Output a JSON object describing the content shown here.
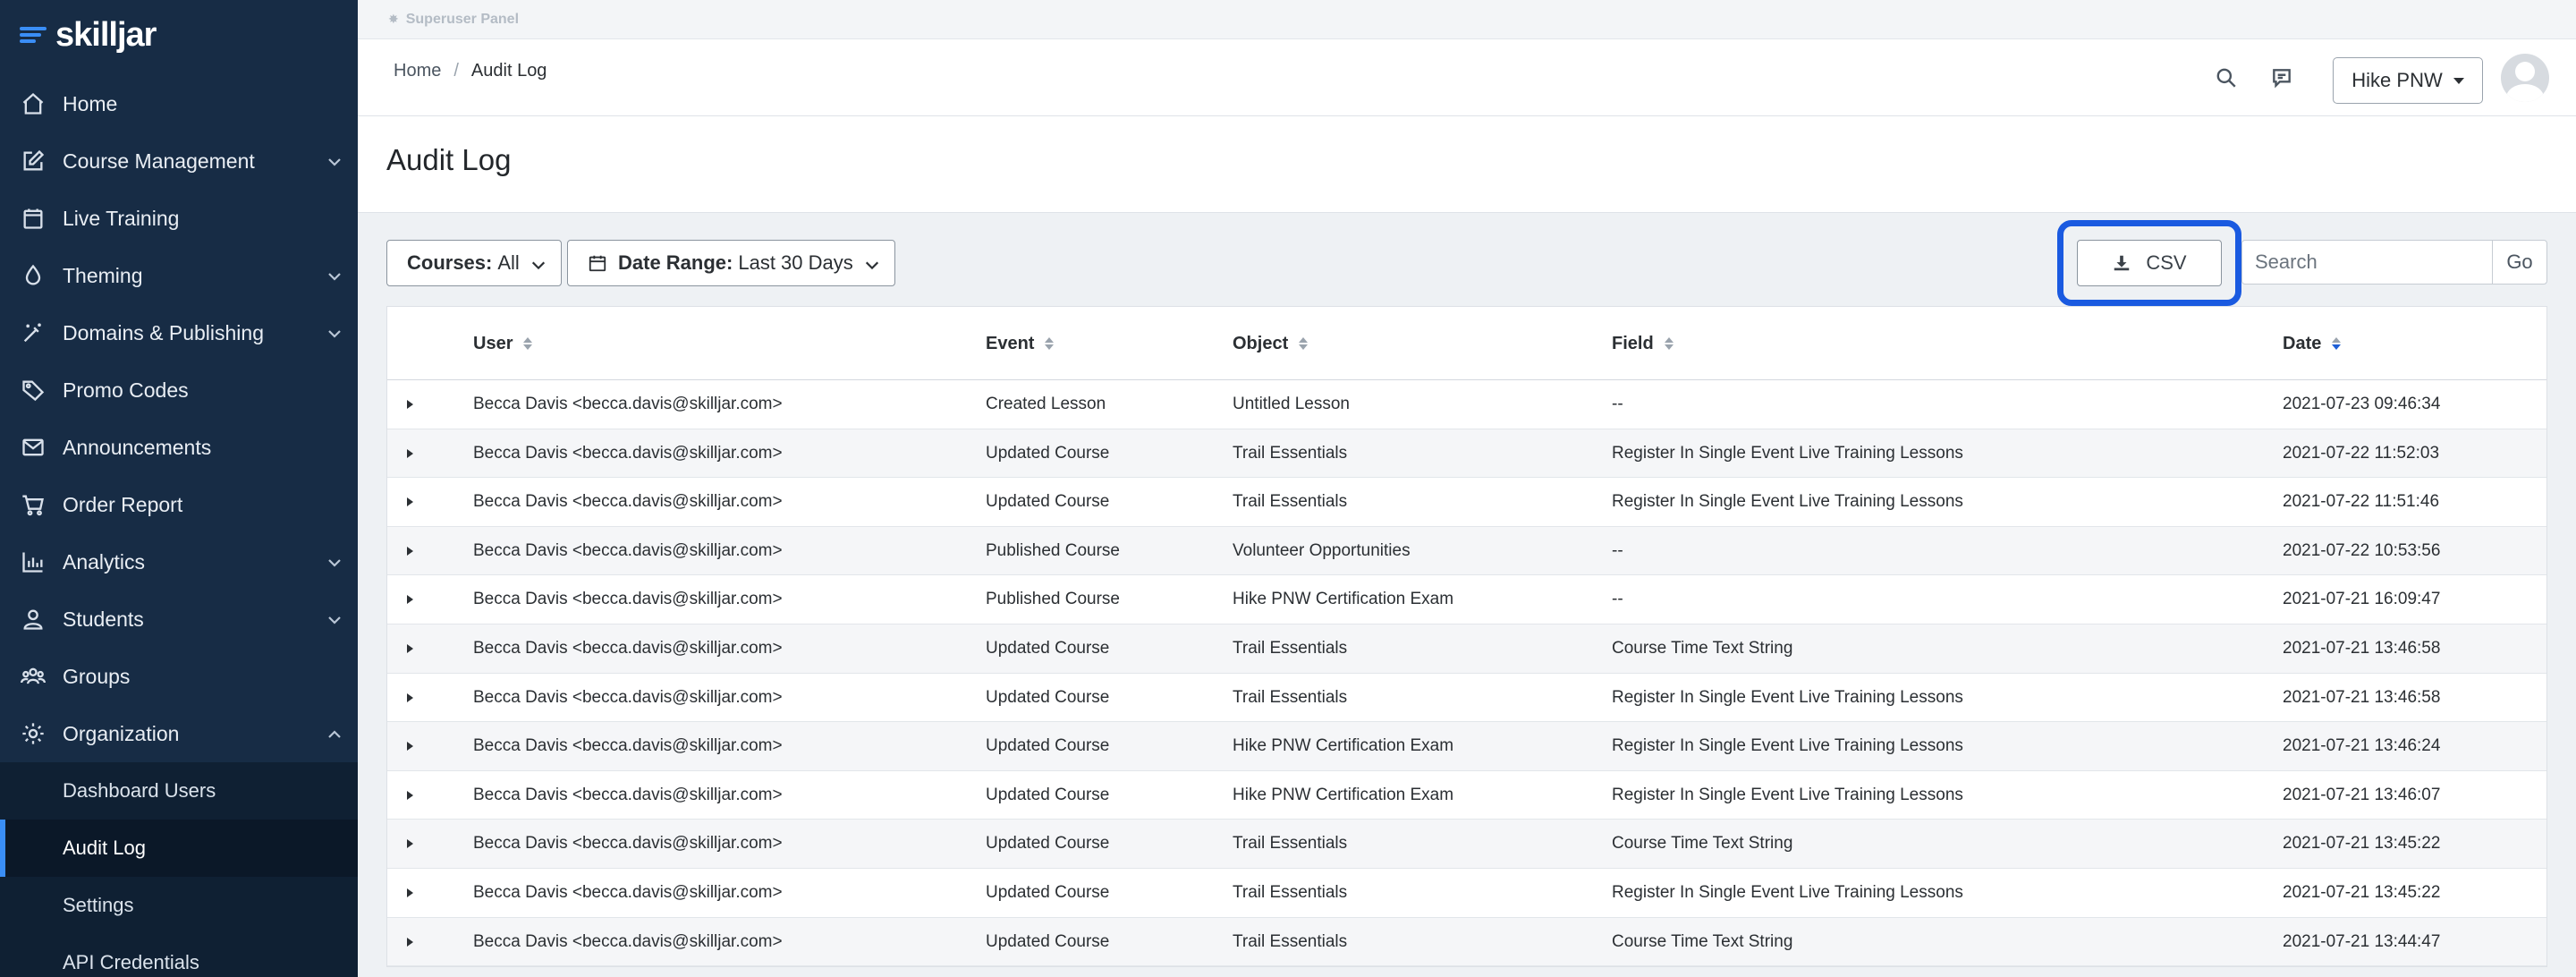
{
  "brand": {
    "name": "skilljar",
    "accent": "#3a8ef6"
  },
  "sidebar": {
    "items": [
      {
        "label": "Home",
        "icon": "home-icon",
        "expandable": false
      },
      {
        "label": "Course Management",
        "icon": "edit-icon",
        "expandable": true
      },
      {
        "label": "Live Training",
        "icon": "calendar-icon",
        "expandable": false
      },
      {
        "label": "Theming",
        "icon": "droplet-icon",
        "expandable": true
      },
      {
        "label": "Domains & Publishing",
        "icon": "magic-wand-icon",
        "expandable": true
      },
      {
        "label": "Promo Codes",
        "icon": "tag-icon",
        "expandable": false
      },
      {
        "label": "Announcements",
        "icon": "envelope-icon",
        "expandable": false
      },
      {
        "label": "Order Report",
        "icon": "cart-icon",
        "expandable": false
      },
      {
        "label": "Analytics",
        "icon": "bar-chart-icon",
        "expandable": true
      },
      {
        "label": "Students",
        "icon": "user-icon",
        "expandable": true
      },
      {
        "label": "Groups",
        "icon": "users-icon",
        "expandable": false
      },
      {
        "label": "Organization",
        "icon": "gear-icon",
        "expandable": true,
        "expanded": true
      }
    ],
    "subitems": [
      {
        "label": "Dashboard Users",
        "active": false
      },
      {
        "label": "Audit Log",
        "active": true
      },
      {
        "label": "Settings",
        "active": false
      },
      {
        "label": "API Credentials",
        "active": false
      }
    ]
  },
  "superuser": {
    "label": "Superuser Panel"
  },
  "breadcrumb": {
    "home": "Home",
    "separator": "/",
    "current": "Audit Log"
  },
  "header": {
    "org_name": "Hike PNW"
  },
  "page": {
    "title": "Audit Log"
  },
  "filters": {
    "courses_label": "Courses:",
    "courses_value": "All",
    "date_label": "Date Range:",
    "date_value": "Last 30 Days"
  },
  "toolbar": {
    "csv_label": "CSV",
    "search_placeholder": "Search",
    "go_label": "Go",
    "highlight_color": "#1a5ae0"
  },
  "table": {
    "columns": [
      "User",
      "Event",
      "Object",
      "Field",
      "Date"
    ],
    "sorted_column": "Date",
    "rows": [
      [
        "Becca Davis <becca.davis@skilljar.com>",
        "Created Lesson",
        "Untitled Lesson",
        "--",
        "2021-07-23 09:46:34"
      ],
      [
        "Becca Davis <becca.davis@skilljar.com>",
        "Updated Course",
        "Trail Essentials",
        "Register In Single Event Live Training Lessons",
        "2021-07-22 11:52:03"
      ],
      [
        "Becca Davis <becca.davis@skilljar.com>",
        "Updated Course",
        "Trail Essentials",
        "Register In Single Event Live Training Lessons",
        "2021-07-22 11:51:46"
      ],
      [
        "Becca Davis <becca.davis@skilljar.com>",
        "Published Course",
        "Volunteer Opportunities",
        "--",
        "2021-07-22 10:53:56"
      ],
      [
        "Becca Davis <becca.davis@skilljar.com>",
        "Published Course",
        "Hike PNW Certification Exam",
        "--",
        "2021-07-21 16:09:47"
      ],
      [
        "Becca Davis <becca.davis@skilljar.com>",
        "Updated Course",
        "Trail Essentials",
        "Course Time Text String",
        "2021-07-21 13:46:58"
      ],
      [
        "Becca Davis <becca.davis@skilljar.com>",
        "Updated Course",
        "Trail Essentials",
        "Register In Single Event Live Training Lessons",
        "2021-07-21 13:46:58"
      ],
      [
        "Becca Davis <becca.davis@skilljar.com>",
        "Updated Course",
        "Hike PNW Certification Exam",
        "Register In Single Event Live Training Lessons",
        "2021-07-21 13:46:24"
      ],
      [
        "Becca Davis <becca.davis@skilljar.com>",
        "Updated Course",
        "Hike PNW Certification Exam",
        "Register In Single Event Live Training Lessons",
        "2021-07-21 13:46:07"
      ],
      [
        "Becca Davis <becca.davis@skilljar.com>",
        "Updated Course",
        "Trail Essentials",
        "Course Time Text String",
        "2021-07-21 13:45:22"
      ],
      [
        "Becca Davis <becca.davis@skilljar.com>",
        "Updated Course",
        "Trail Essentials",
        "Register In Single Event Live Training Lessons",
        "2021-07-21 13:45:22"
      ],
      [
        "Becca Davis <becca.davis@skilljar.com>",
        "Updated Course",
        "Trail Essentials",
        "Course Time Text String",
        "2021-07-21 13:44:47"
      ]
    ]
  }
}
